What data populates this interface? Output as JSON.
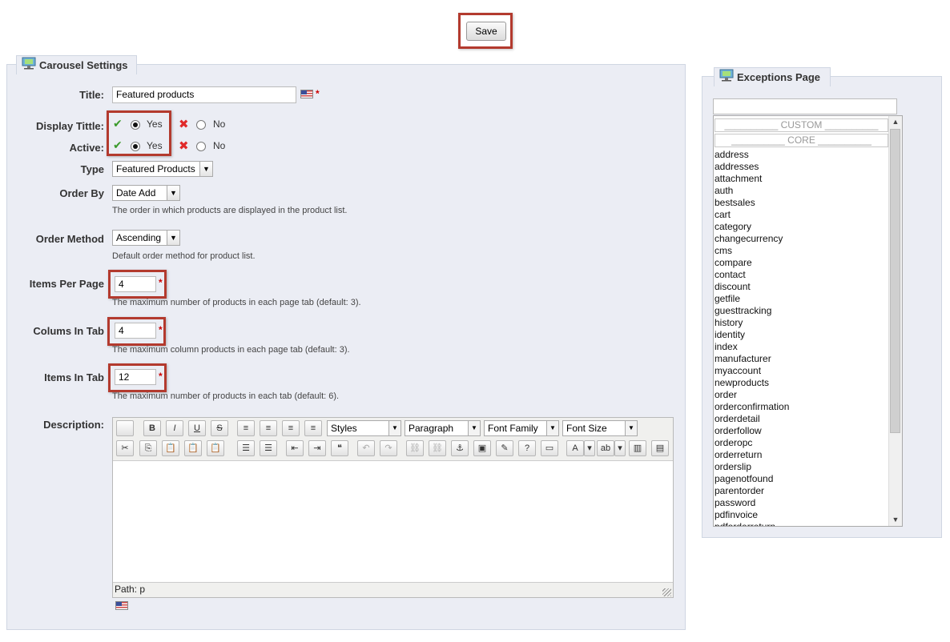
{
  "save_label": "Save",
  "carousel": {
    "legend": "Carousel Settings",
    "title_label": "Title:",
    "title_value": "Featured products",
    "display_title_label": "Display Tittle:",
    "active_label": "Active:",
    "yes_label": "Yes",
    "no_label": "No",
    "type_label": "Type",
    "type_value": "Featured Products",
    "order_by_label": "Order By",
    "order_by_value": "Date Add",
    "order_by_hint": "The order in which products are displayed in the product list.",
    "order_method_label": "Order Method",
    "order_method_value": "Ascending",
    "order_method_hint": "Default order method for product list.",
    "items_per_page_label": "Items Per Page",
    "items_per_page_value": "4",
    "items_per_page_hint": "The maximum number of products in each page tab (default: 3).",
    "columns_label": "Colums In Tab",
    "columns_value": "4",
    "columns_hint": "The maximum column products in each page tab (default: 3).",
    "items_in_tab_label": "Items In Tab",
    "items_in_tab_value": "12",
    "items_in_tab_hint": "The maximum number of products in each tab (default: 6).",
    "description_label": "Description:",
    "required_mark": "*"
  },
  "editor": {
    "styles": "Styles",
    "format": "Paragraph",
    "font_family": "Font Family",
    "font_size": "Font Size",
    "path": "Path: p",
    "row1_icons": [
      "new-document-icon",
      "bold-icon",
      "italic-icon",
      "underline-icon",
      "strikethrough-icon",
      "align-left-icon",
      "align-center-icon",
      "align-right-icon",
      "align-justify-icon"
    ],
    "row1_glyphs": [
      "",
      "B",
      "I",
      "U",
      "S",
      "≡",
      "≡",
      "≡",
      "≡"
    ],
    "row2_icons": [
      "cut-icon",
      "copy-icon",
      "paste-icon",
      "paste-text-icon",
      "paste-word-icon",
      "bullet-list-icon",
      "numbered-list-icon",
      "outdent-icon",
      "indent-icon",
      "blockquote-icon",
      "undo-icon",
      "redo-icon",
      "link-icon",
      "unlink-icon",
      "anchor-icon",
      "image-icon",
      "cleanup-icon",
      "help-icon",
      "html-icon",
      "text-color-icon",
      "text-color-dropdown-icon",
      "highlight-color-icon",
      "highlight-color-dropdown-icon",
      "media-icon",
      "template-icon"
    ],
    "row2_glyphs": [
      "✂",
      "⎘",
      "📋",
      "📋",
      "📋",
      "☰",
      "☰",
      "⇤",
      "⇥",
      "❝",
      "↶",
      "↷",
      "⛓",
      "⛓",
      "⚓",
      "▣",
      "✎",
      "?",
      "▭",
      "A",
      "▾",
      "ab",
      "▾",
      "▥",
      "▤"
    ]
  },
  "exceptions": {
    "legend": "Exceptions Page",
    "search_value": "",
    "groups": [
      "__________ CUSTOM __________",
      "__________ CORE __________"
    ],
    "items": [
      "address",
      "addresses",
      "attachment",
      "auth",
      "bestsales",
      "cart",
      "category",
      "changecurrency",
      "cms",
      "compare",
      "contact",
      "discount",
      "getfile",
      "guesttracking",
      "history",
      "identity",
      "index",
      "manufacturer",
      "myaccount",
      "newproducts",
      "order",
      "orderconfirmation",
      "orderdetail",
      "orderfollow",
      "orderopc",
      "orderreturn",
      "orderslip",
      "pagenotfound",
      "parentorder",
      "password",
      "pdfinvoice",
      "pdforderreturn"
    ]
  },
  "colors": {
    "highlight": "#b33a2e",
    "panel": "#ebedf4",
    "panel_border": "#cfd6e2",
    "required": "#cc0000"
  }
}
